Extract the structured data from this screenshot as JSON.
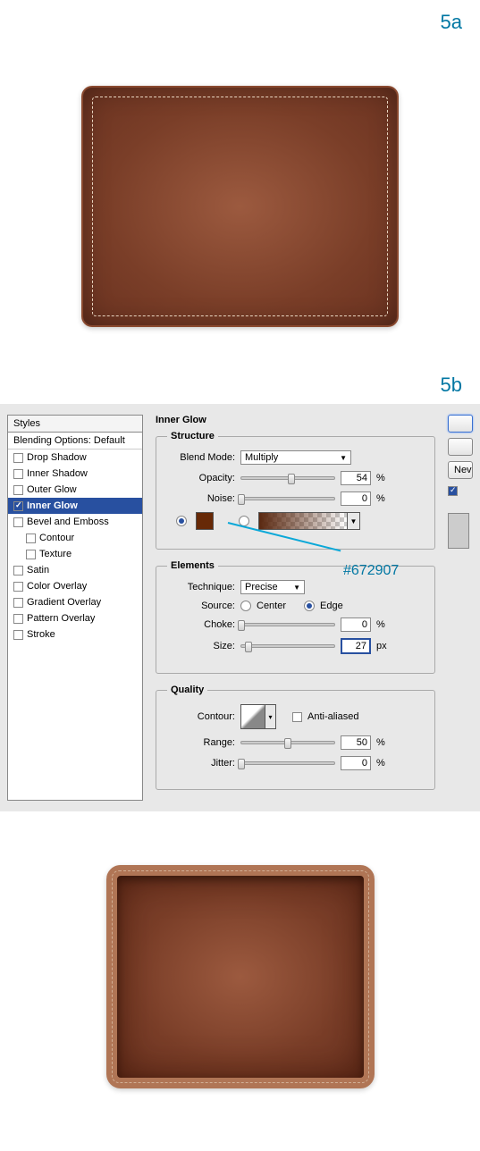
{
  "steps": {
    "a": "5a",
    "b": "5b"
  },
  "styles_panel": {
    "header": "Styles",
    "subheader": "Blending Options: Default",
    "items": [
      {
        "label": "Drop Shadow",
        "checked": false,
        "selected": false
      },
      {
        "label": "Inner Shadow",
        "checked": false,
        "selected": false
      },
      {
        "label": "Outer Glow",
        "checked": false,
        "selected": false
      },
      {
        "label": "Inner Glow",
        "checked": true,
        "selected": true
      },
      {
        "label": "Bevel and Emboss",
        "checked": false,
        "selected": false
      },
      {
        "label": "Contour",
        "checked": false,
        "selected": false,
        "indent": true
      },
      {
        "label": "Texture",
        "checked": false,
        "selected": false,
        "indent": true
      },
      {
        "label": "Satin",
        "checked": false,
        "selected": false
      },
      {
        "label": "Color Overlay",
        "checked": false,
        "selected": false
      },
      {
        "label": "Gradient Overlay",
        "checked": false,
        "selected": false
      },
      {
        "label": "Pattern Overlay",
        "checked": false,
        "selected": false
      },
      {
        "label": "Stroke",
        "checked": false,
        "selected": false
      }
    ]
  },
  "panel": {
    "title": "Inner Glow",
    "structure": {
      "legend": "Structure",
      "blend_label": "Blend Mode:",
      "blend_value": "Multiply",
      "opacity_label": "Opacity:",
      "opacity_value": "54",
      "opacity_unit": "%",
      "noise_label": "Noise:",
      "noise_value": "0",
      "noise_unit": "%",
      "color_hex": "#672907"
    },
    "elements": {
      "legend": "Elements",
      "technique_label": "Technique:",
      "technique_value": "Precise",
      "source_label": "Source:",
      "source_center": "Center",
      "source_edge": "Edge",
      "choke_label": "Choke:",
      "choke_value": "0",
      "choke_unit": "%",
      "size_label": "Size:",
      "size_value": "27",
      "size_unit": "px"
    },
    "quality": {
      "legend": "Quality",
      "contour_label": "Contour:",
      "aa_label": "Anti-aliased",
      "range_label": "Range:",
      "range_value": "50",
      "range_unit": "%",
      "jitter_label": "Jitter:",
      "jitter_value": "0",
      "jitter_unit": "%"
    }
  },
  "buttons": {
    "new": "Nev"
  },
  "annotation": {
    "color_label": "#672907"
  }
}
